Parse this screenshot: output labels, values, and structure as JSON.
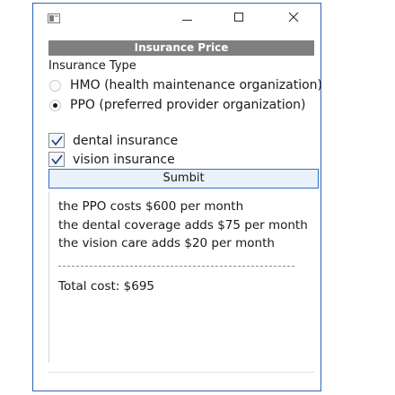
{
  "window": {
    "icons": {
      "app": "app-window-icon",
      "minimize": "minimize-icon",
      "maximize": "maximize-icon",
      "close": "close-icon"
    },
    "border_color": "#2e62b5"
  },
  "header": {
    "title": "Insurance Price",
    "background": "#7f7f7f"
  },
  "insurance_type": {
    "label": "Insurance Type",
    "options": [
      {
        "label": "HMO (health maintenance organization)",
        "selected": false
      },
      {
        "label": "PPO (preferred provider organization)",
        "selected": true
      }
    ]
  },
  "extras": [
    {
      "label": "dental insurance",
      "checked": true
    },
    {
      "label": "vision insurance",
      "checked": true
    }
  ],
  "submit": {
    "label": "Sumbit"
  },
  "results": {
    "lines": [
      "the PPO costs $600 per month",
      "the dental coverage adds $75 per month",
      "the vision care adds $20 per month"
    ],
    "total": "Total cost: $695"
  }
}
